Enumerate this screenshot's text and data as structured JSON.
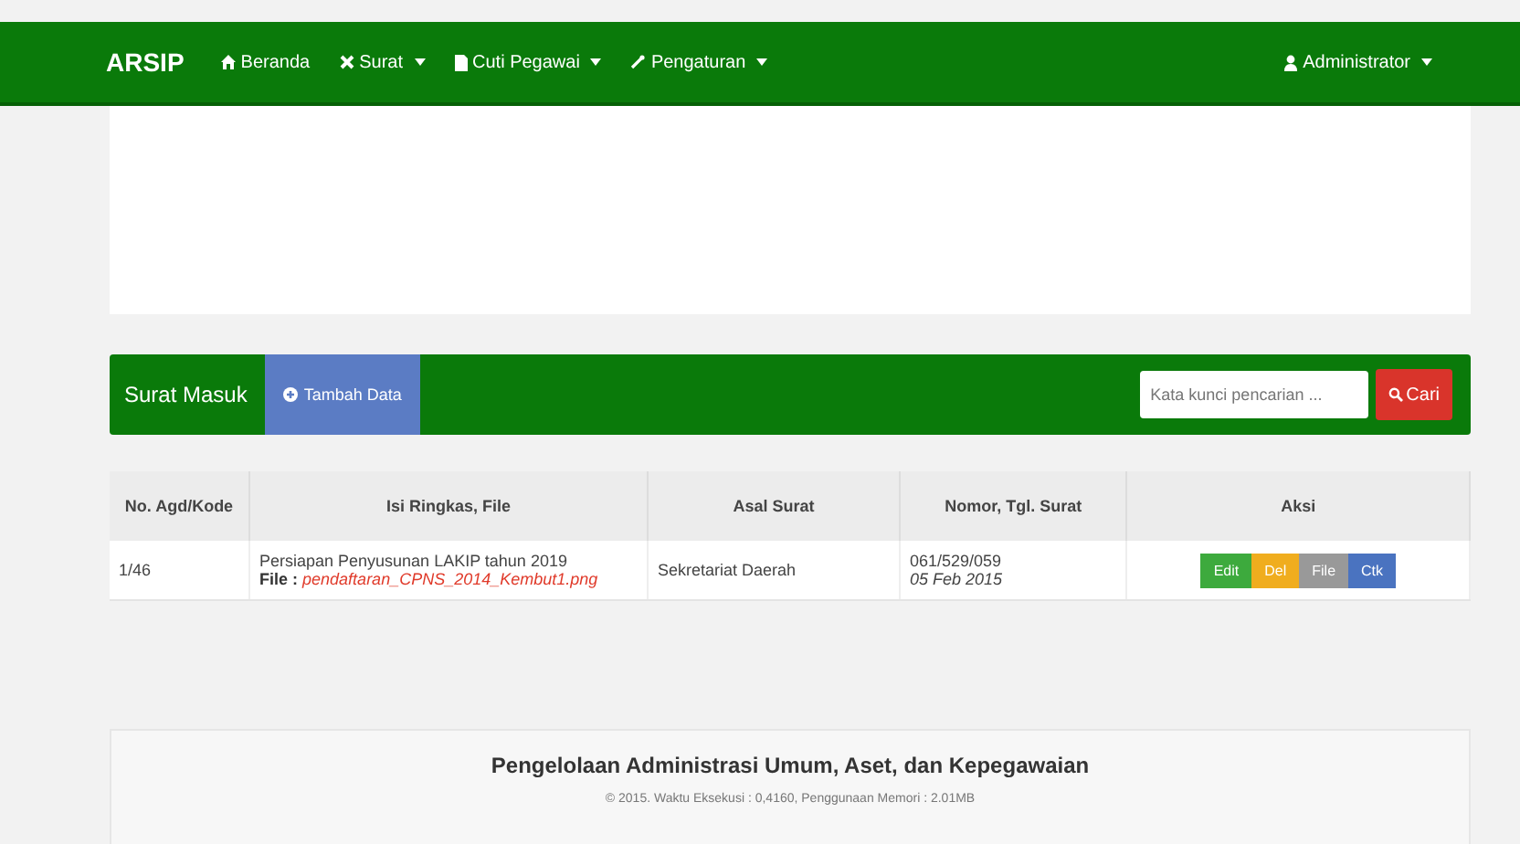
{
  "navbar": {
    "brand": "ARSIP",
    "items": [
      {
        "label": "Beranda",
        "kind": "home",
        "dropdown": false
      },
      {
        "label": "Surat",
        "kind": "cross",
        "dropdown": true
      },
      {
        "label": "Cuti Pegawai",
        "kind": "doc",
        "dropdown": true
      },
      {
        "label": "Pengaturan",
        "kind": "wrench",
        "dropdown": true
      }
    ],
    "user": "Administrator"
  },
  "panel": {
    "title": "Surat Masuk",
    "add_button": "Tambah Data",
    "search": {
      "placeholder": "Kata kunci pencarian ..."
    },
    "search_button": "Cari"
  },
  "table": {
    "columns": [
      "No. Agd/Kode",
      "Isi Ringkas, File",
      "Asal Surat",
      "Nomor, Tgl. Surat",
      "Aksi"
    ],
    "rows": [
      {
        "code": "1/46",
        "summary": "Persiapan Penyusunan LAKIP tahun 2019",
        "file_label": "File :",
        "file": "pendaftaran_CPNS_2014_Kembut1.png",
        "origin": "Sekretariat Daerah",
        "number": "061/529/059",
        "date": "05 Feb 2015",
        "actions": [
          {
            "label": "Edit",
            "kind": "edit"
          },
          {
            "label": "Del",
            "kind": "del"
          },
          {
            "label": "File",
            "kind": "file"
          },
          {
            "label": "Ctk",
            "kind": "print"
          }
        ]
      }
    ]
  },
  "footer": {
    "title": "Pengelolaan Administrasi Umum, Aset, dan Kepegawaian",
    "note": "© 2015. Waktu Eksekusi : 0,4160, Penggunaan Memori : 2.01MB"
  }
}
